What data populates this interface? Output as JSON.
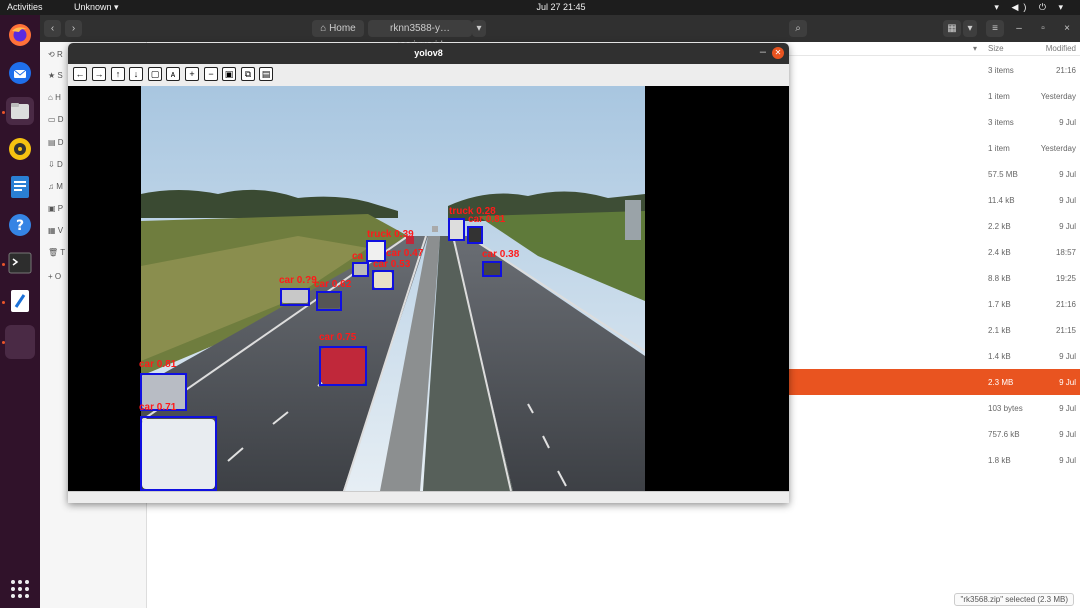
{
  "topbar": {
    "activities": "Activities",
    "app_menu": "Unknown ▾",
    "clock": "Jul 27  21:45",
    "tray": "▾ ◀) ⏻ ▾"
  },
  "files": {
    "breadcrumb_home": "⌂  Home",
    "breadcrumb_folder": "rknn3588-y…nosigmoid",
    "breadcrumb_dropdown": "▾",
    "nav_back": "‹",
    "nav_forward": "›",
    "search_icon": "⌕",
    "view_grid": "▦",
    "view_dropdown": "▾",
    "menu": "≡",
    "win_min": "–",
    "win_max": "▫",
    "win_close": "×",
    "columns": {
      "size": "Size",
      "modified": "Modified",
      "sort": "▾"
    },
    "sidebar": [
      {
        "icon": "⟲",
        "label": "R"
      },
      {
        "icon": "★",
        "label": "S"
      },
      {
        "icon": "⌂",
        "label": "H"
      },
      {
        "icon": "▭",
        "label": "D"
      },
      {
        "icon": "▤",
        "label": "D"
      },
      {
        "icon": "⇩",
        "label": "D"
      },
      {
        "icon": "♫",
        "label": "M"
      },
      {
        "icon": "▣",
        "label": "P"
      },
      {
        "icon": "▦",
        "label": "V"
      },
      {
        "icon": "🗑",
        "label": "T"
      },
      {
        "icon": "+",
        "label": "O"
      }
    ],
    "rows": [
      {
        "size": "3 items",
        "modified": "21:16"
      },
      {
        "size": "1 item",
        "modified": "Yesterday"
      },
      {
        "size": "3 items",
        "modified": "9 Jul"
      },
      {
        "size": "1 item",
        "modified": "Yesterday"
      },
      {
        "size": "57.5 MB",
        "modified": "9 Jul"
      },
      {
        "size": "11.4 kB",
        "modified": "9 Jul"
      },
      {
        "size": "2.2 kB",
        "modified": "9 Jul"
      },
      {
        "size": "2.4 kB",
        "modified": "18:57"
      },
      {
        "size": "8.8 kB",
        "modified": "19:25"
      },
      {
        "size": "1.7 kB",
        "modified": "21:16"
      },
      {
        "size": "2.1 kB",
        "modified": "21:15"
      },
      {
        "size": "1.4 kB",
        "modified": "9 Jul"
      },
      {
        "size": "2.3 MB",
        "modified": "9 Jul"
      },
      {
        "size": "103 bytes",
        "modified": "9 Jul"
      },
      {
        "size": "757.6 kB",
        "modified": "9 Jul"
      },
      {
        "size": "1.8 kB",
        "modified": "9 Jul"
      }
    ],
    "selected_row": 12,
    "status": "\"rk3568.zip\" selected  (2.3 MB)"
  },
  "yolo_window": {
    "title": "yolov8",
    "minimize": "–",
    "close": "✕",
    "toolbar": [
      {
        "name": "pan-left-button",
        "glyph": "←"
      },
      {
        "name": "pan-right-button",
        "glyph": "→"
      },
      {
        "name": "pan-up-button",
        "glyph": "↑"
      },
      {
        "name": "pan-down-button",
        "glyph": "↓"
      },
      {
        "name": "zoom-rect-button",
        "glyph": "▢"
      },
      {
        "name": "zoom-x30-button",
        "glyph": "ᴀ"
      },
      {
        "name": "zoom-in-button",
        "glyph": "+"
      },
      {
        "name": "zoom-out-button",
        "glyph": "−"
      },
      {
        "name": "save-image-button",
        "glyph": "▣"
      },
      {
        "name": "copy-button",
        "glyph": "⧉"
      },
      {
        "name": "properties-button",
        "glyph": "▤"
      }
    ],
    "detections": [
      {
        "label": "car 0.81"
      },
      {
        "label": "car 0.71"
      },
      {
        "label": "car 0.75"
      },
      {
        "label": "car 0.?9"
      },
      {
        "label": "car 0.62"
      },
      {
        "label": "truck 0.39"
      },
      {
        "label": "car 0.47"
      },
      {
        "label": "car 0.53"
      },
      {
        "label": "ca"
      },
      {
        "label": "truck 0.28"
      },
      {
        "label": "car 0.81"
      },
      {
        "label": "car 0.38"
      }
    ]
  }
}
